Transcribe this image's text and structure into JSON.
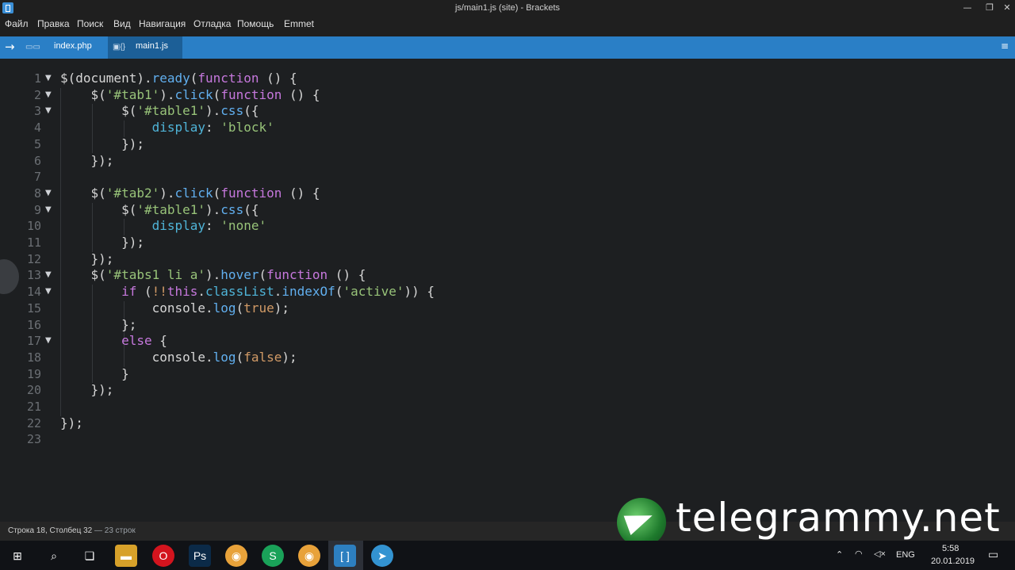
{
  "window": {
    "title": "js/main1.js (site) - Brackets",
    "controls": [
      "—",
      "❐",
      "✕"
    ]
  },
  "menu": [
    "Файл",
    "Правка",
    "Поиск",
    "Вид",
    "Навигация",
    "Отладка",
    "Помощь",
    "Emmet"
  ],
  "tabs": [
    {
      "label": "index.php",
      "icon": "php-file-icon",
      "active": false
    },
    {
      "label": "main1.js",
      "icon": "js-file-icon",
      "active": true
    }
  ],
  "editor": {
    "line_numbers": [
      "1",
      "2",
      "3",
      "4",
      "5",
      "6",
      "7",
      "8",
      "9",
      "10",
      "11",
      "12",
      "13",
      "14",
      "15",
      "16",
      "17",
      "18",
      "19",
      "20",
      "21",
      "22",
      "23"
    ],
    "fold_lines": [
      1,
      2,
      3,
      8,
      9,
      13,
      14,
      17
    ],
    "lines": [
      [
        [
          "$(document).",
          ""
        ],
        [
          "ready",
          "fn"
        ],
        [
          "(",
          ""
        ],
        [
          "function",
          "kw"
        ],
        [
          " () {",
          ""
        ]
      ],
      [
        [
          "    $(",
          ""
        ],
        [
          "'#tab1'",
          "str"
        ],
        [
          ").",
          ""
        ],
        [
          "click",
          "fn"
        ],
        [
          "(",
          ""
        ],
        [
          "function",
          "kw"
        ],
        [
          " () {",
          ""
        ]
      ],
      [
        [
          "        $(",
          ""
        ],
        [
          "'#table1'",
          "str"
        ],
        [
          ").",
          ""
        ],
        [
          "css",
          "fn"
        ],
        [
          "({",
          ""
        ]
      ],
      [
        [
          "            ",
          ""
        ],
        [
          "display",
          "prop"
        ],
        [
          ": ",
          ""
        ],
        [
          "'block'",
          "str"
        ]
      ],
      [
        [
          "        });",
          ""
        ]
      ],
      [
        [
          "    });",
          ""
        ]
      ],
      [
        [
          "",
          ""
        ]
      ],
      [
        [
          "    $(",
          ""
        ],
        [
          "'#tab2'",
          "str"
        ],
        [
          ").",
          ""
        ],
        [
          "click",
          "fn"
        ],
        [
          "(",
          ""
        ],
        [
          "function",
          "kw"
        ],
        [
          " () {",
          ""
        ]
      ],
      [
        [
          "        $(",
          ""
        ],
        [
          "'#table1'",
          "str"
        ],
        [
          ").",
          ""
        ],
        [
          "css",
          "fn"
        ],
        [
          "({",
          ""
        ]
      ],
      [
        [
          "            ",
          ""
        ],
        [
          "display",
          "prop"
        ],
        [
          ": ",
          ""
        ],
        [
          "'none'",
          "str"
        ]
      ],
      [
        [
          "        });",
          ""
        ]
      ],
      [
        [
          "    });",
          ""
        ]
      ],
      [
        [
          "    $(",
          ""
        ],
        [
          "'#tabs1 li a'",
          "str"
        ],
        [
          ").",
          ""
        ],
        [
          "hover",
          "fn"
        ],
        [
          "(",
          ""
        ],
        [
          "function",
          "kw"
        ],
        [
          " () {",
          ""
        ]
      ],
      [
        [
          "        ",
          ""
        ],
        [
          "if",
          "kw"
        ],
        [
          " (",
          ""
        ],
        [
          "!!",
          "lit"
        ],
        [
          "this",
          "kw"
        ],
        [
          ".",
          ""
        ],
        [
          "classList",
          "prop"
        ],
        [
          ".",
          ""
        ],
        [
          "indexOf",
          "fn"
        ],
        [
          "(",
          ""
        ],
        [
          "'active'",
          "str"
        ],
        [
          ")) {",
          ""
        ]
      ],
      [
        [
          "            console.",
          ""
        ],
        [
          "log",
          "fn"
        ],
        [
          "(",
          ""
        ],
        [
          "true",
          "lit"
        ],
        [
          ");",
          ""
        ]
      ],
      [
        [
          "        };",
          ""
        ]
      ],
      [
        [
          "        ",
          ""
        ],
        [
          "else",
          "kw"
        ],
        [
          " {",
          ""
        ]
      ],
      [
        [
          "            console.",
          ""
        ],
        [
          "log",
          "fn"
        ],
        [
          "(",
          ""
        ],
        [
          "false",
          "lit"
        ],
        [
          ");",
          ""
        ]
      ],
      [
        [
          "        }",
          ""
        ]
      ],
      [
        [
          "    });",
          ""
        ]
      ],
      [
        [
          "",
          ""
        ]
      ],
      [
        [
          "});",
          ""
        ]
      ],
      [
        [
          "",
          ""
        ]
      ]
    ]
  },
  "status": {
    "position": "Строка 18, Столбец 32",
    "lines": "— 23 строк"
  },
  "watermark": {
    "text": "telegrammy.net",
    "icon": "telegram-globe-icon"
  },
  "taskbar": {
    "items": [
      {
        "name": "windows-start-icon",
        "glyph": "⊞"
      },
      {
        "name": "search-icon",
        "glyph": "⌕"
      },
      {
        "name": "task-view-icon",
        "glyph": "❏"
      },
      {
        "name": "explorer-icon",
        "glyph": "▬"
      },
      {
        "name": "opera-icon",
        "glyph": "O"
      },
      {
        "name": "photoshop-icon",
        "glyph": "Ps"
      },
      {
        "name": "chrome-icon",
        "glyph": "◉"
      },
      {
        "name": "skype-icon",
        "glyph": "S"
      },
      {
        "name": "chrome-profile-icon",
        "glyph": "◉"
      },
      {
        "name": "brackets-icon",
        "glyph": "[ ]"
      },
      {
        "name": "telegram-icon",
        "glyph": "➤"
      }
    ],
    "tray": {
      "lang": "ENG",
      "time": "5:58",
      "date": "20.01.2019"
    }
  }
}
